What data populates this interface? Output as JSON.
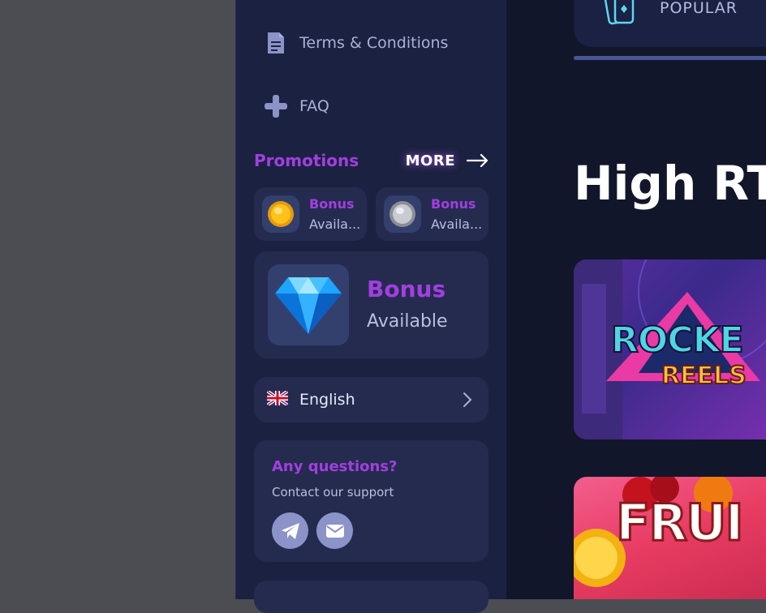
{
  "sidebar": {
    "nav": [
      {
        "label": "Terms & Conditions",
        "icon": "document-icon"
      },
      {
        "label": "FAQ",
        "icon": "plus-icon"
      }
    ],
    "promotions": {
      "title": "Promotions",
      "more_label": "MORE",
      "mini_cards": [
        {
          "title": "Bonus",
          "subtitle": "Availa...",
          "icon": "gold-coin-icon"
        },
        {
          "title": "Bonus",
          "subtitle": "Availa...",
          "icon": "silver-coin-icon"
        }
      ],
      "big_card": {
        "title": "Bonus",
        "subtitle": "Available",
        "icon": "diamond-icon"
      }
    },
    "language": {
      "label": "English",
      "flag": "uk-flag-icon"
    },
    "support": {
      "title": "Any questions?",
      "subtitle": "Contact our support",
      "buttons": [
        "telegram-icon",
        "mail-icon"
      ]
    }
  },
  "main": {
    "tab": {
      "label": "POPULAR",
      "icon": "cards-icon"
    },
    "section_title": "High RT",
    "games": [
      {
        "line1": "ROCKE",
        "line2": "REELS"
      },
      {
        "line1": "FRUI"
      }
    ]
  },
  "colors": {
    "accent": "#a23fe0",
    "sidebar_bg": "#1b2140",
    "card_bg": "#242b4f",
    "main_bg": "#12162a"
  }
}
